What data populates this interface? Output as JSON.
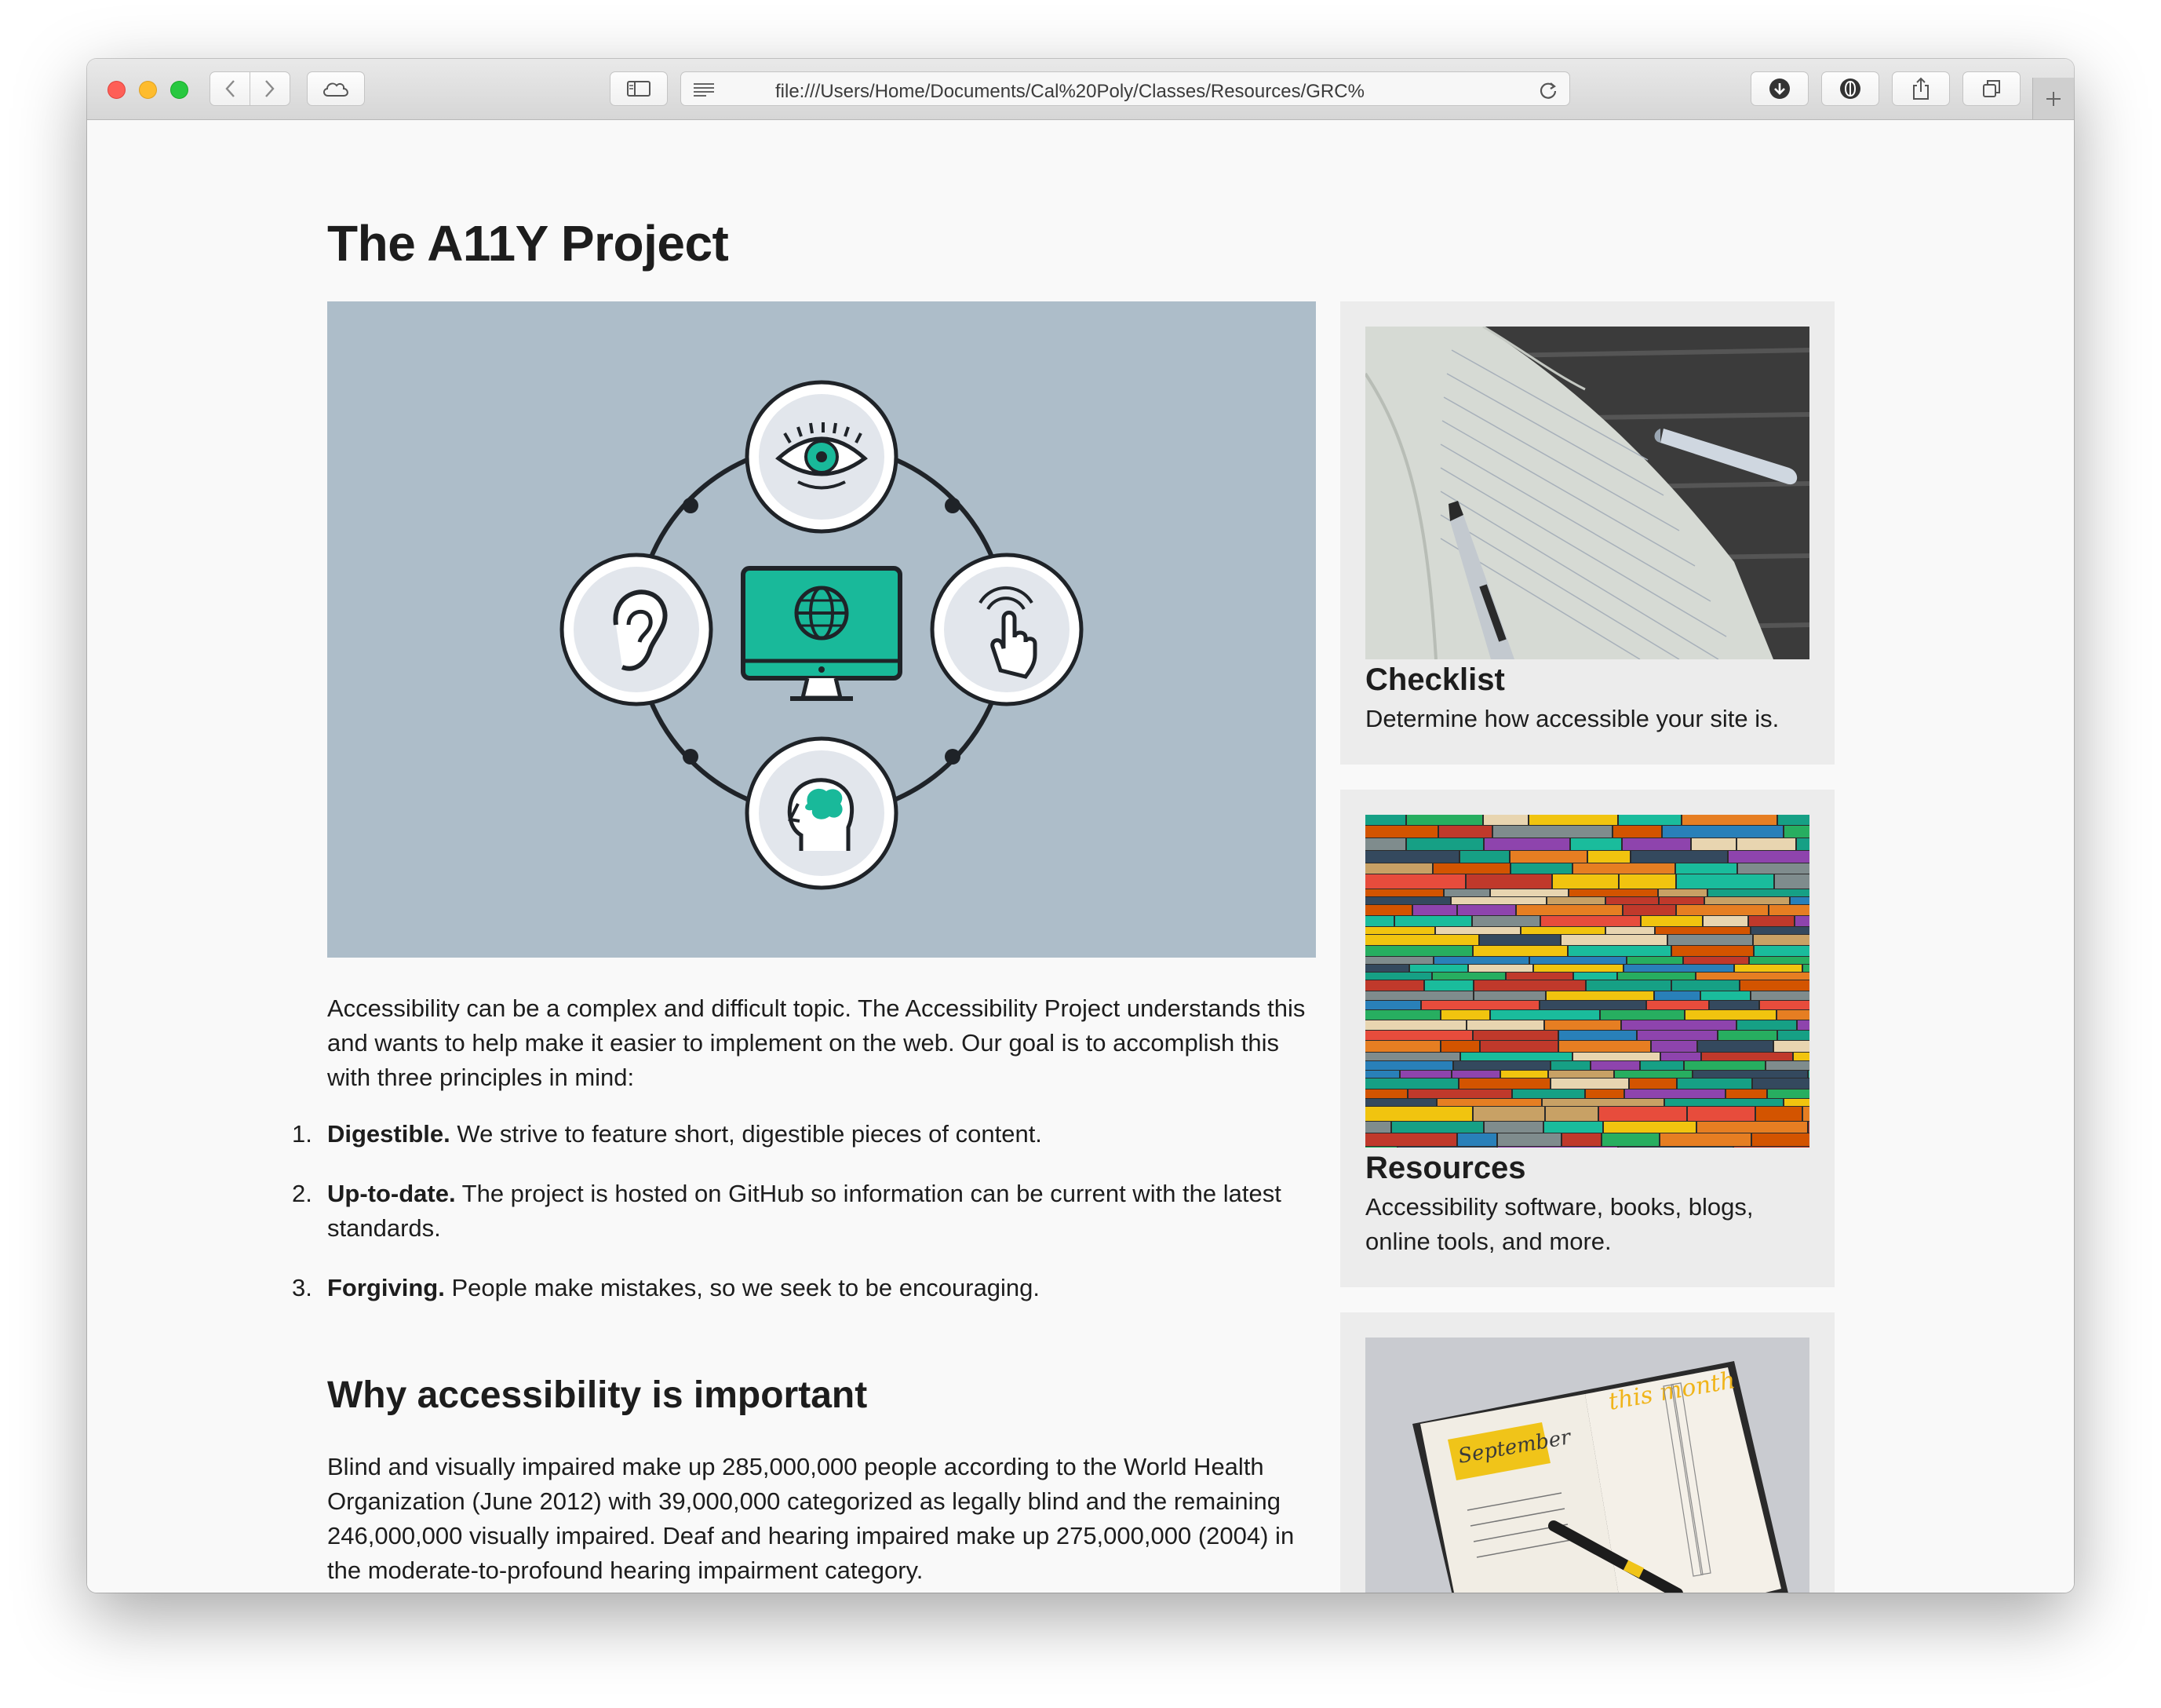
{
  "browser": {
    "address": "file:///Users/Home/Documents/Cal%20Poly/Classes/Resources/GRC%"
  },
  "page": {
    "title": "The A11Y Project",
    "intro": "Accessibility can be a complex and difficult topic. The Accessibility Project understands this and wants to help make it easier to implement on the web. Our goal is to accomplish this with three principles in mind:",
    "principles": [
      {
        "num": "1.",
        "bold": "Digestible.",
        "text": " We strive to feature short, digestible pieces of content."
      },
      {
        "num": "2.",
        "bold": "Up-to-date.",
        "text": " The project is hosted on GitHub so information can be current with the latest standards."
      },
      {
        "num": "3.",
        "bold": "Forgiving.",
        "text": " People make mistakes, so we seek to be encouraging."
      }
    ],
    "why_heading": "Why accessibility is important",
    "why_text": "Blind and visually impaired make up 285,000,000 people according to the World Health Organization (June 2012) with 39,000,000 categorized as legally blind and the remaining 246,000,000 visually impaired. Deaf and hearing impaired make up 275,000,000 (2004) in the moderate-to-profound hearing impairment category."
  },
  "sidebar": {
    "cards": [
      {
        "title": "Checklist",
        "desc": "Determine how accessible your site is."
      },
      {
        "title": "Resources",
        "desc": "Accessibility software, books, blogs, online tools, and more."
      },
      {
        "calendar_month": "September",
        "calendar_heading": "this month"
      }
    ]
  },
  "colors": {
    "close": "#fe5f57",
    "minimize": "#febc2e",
    "zoom": "#28c840",
    "hero_bg": "#adbdc9",
    "accent_teal": "#19b99a",
    "card_bg": "#ececec"
  },
  "icons": [
    "eye-icon",
    "ear-icon",
    "touch-hand-icon",
    "brain-head-icon",
    "globe-monitor-icon"
  ]
}
